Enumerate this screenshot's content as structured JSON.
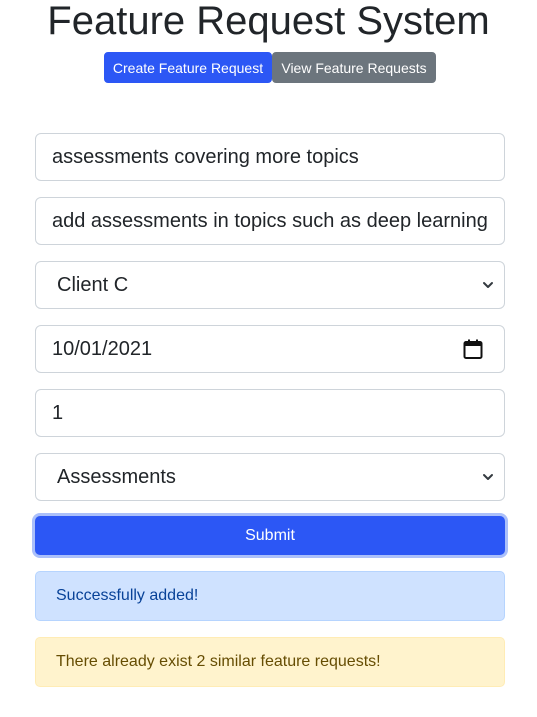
{
  "header": {
    "title": "Feature Request System"
  },
  "nav": {
    "create_label": "Create Feature Request",
    "view_label": "View Feature Requests"
  },
  "form": {
    "title_value": "assessments covering more topics",
    "description_value": "add assessments in topics such as deep learning",
    "client_selected": "Client C",
    "target_date_value": "10/01/2021",
    "priority_value": "1",
    "product_area_selected": "Assessments",
    "submit_label": "Submit"
  },
  "alerts": {
    "success_text": "Successfully added!",
    "warning_text": "There already exist 2 similar feature requests!"
  },
  "colors": {
    "primary": "#2c57f5",
    "secondary": "#6c757d",
    "success_bg": "#cfe2ff",
    "warning_bg": "#fff3cd"
  },
  "icons": {
    "select_arrow": "chevron-down-icon",
    "date_picker": "calendar-icon"
  }
}
